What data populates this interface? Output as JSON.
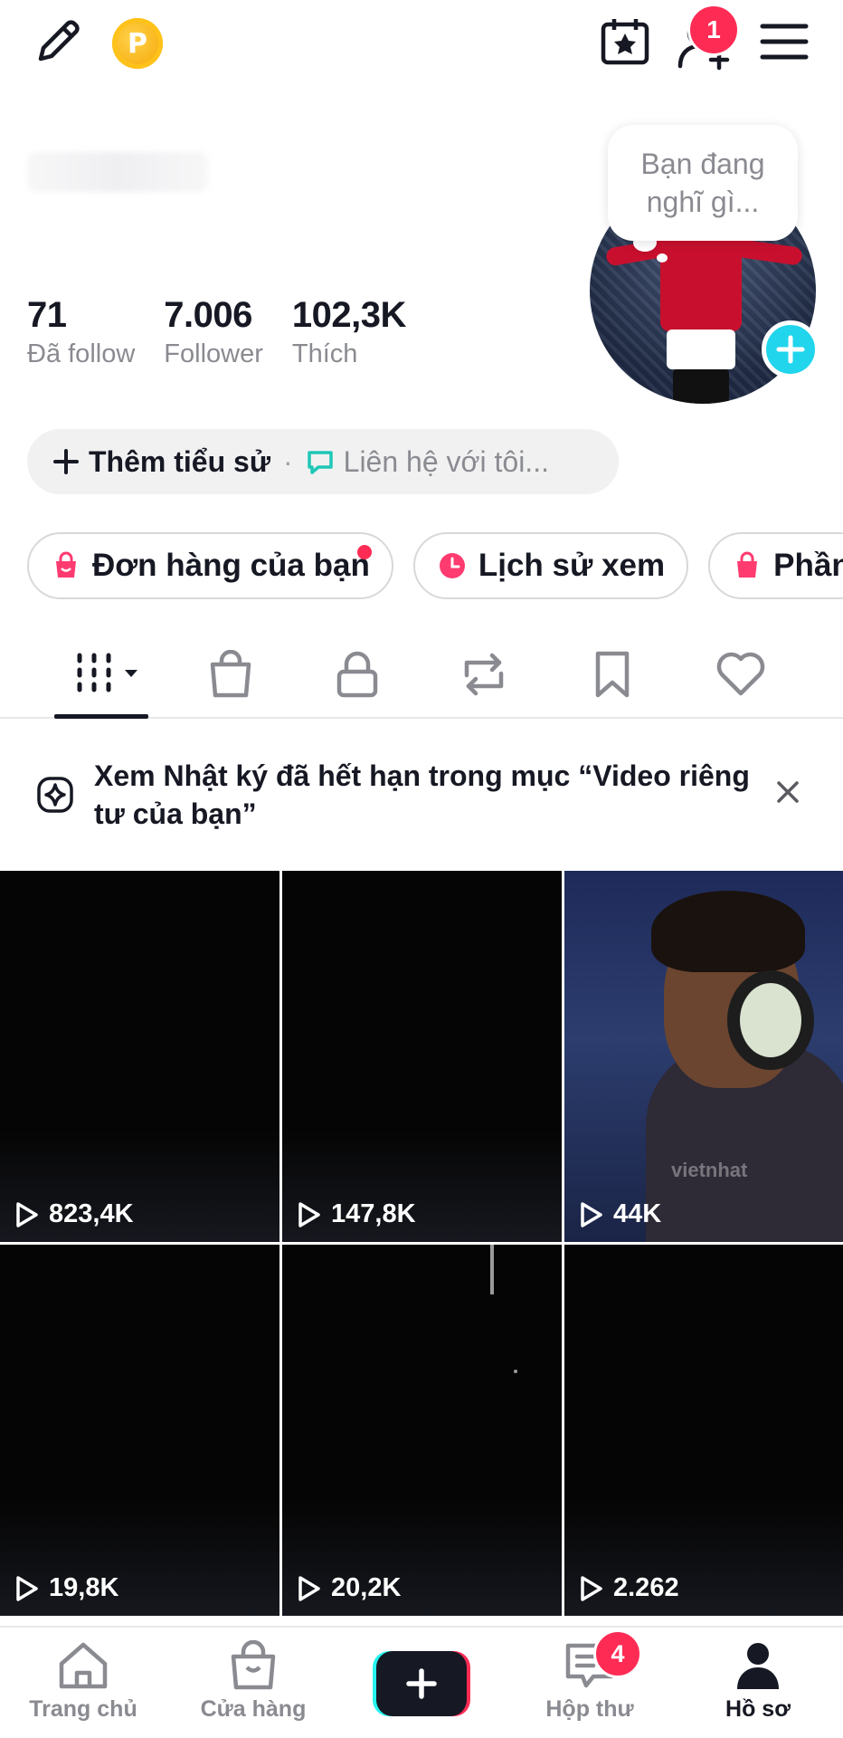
{
  "topbar": {
    "edit_icon": "pencil-icon",
    "points_badge": "P",
    "calendar_icon": "calendar-star-icon",
    "add_friend_badge": "1",
    "menu_icon": "hamburger-icon"
  },
  "profile": {
    "thought_bubble": "Bạn đang nghĩ gì...",
    "stats": [
      {
        "value": "71",
        "label": "Đã follow"
      },
      {
        "value": "7.006",
        "label": "Follower"
      },
      {
        "value": "102,3K",
        "label": "Thích"
      }
    ],
    "add_bio": "Thêm tiểu sử",
    "separator": "·",
    "contact": "Liên hệ với tôi..."
  },
  "chips": [
    {
      "label": "Đơn hàng của bạn",
      "icon": "shopping-bag-icon"
    },
    {
      "label": "Lịch sử xem",
      "icon": "clock-icon"
    },
    {
      "label": "Phần",
      "icon": "shopping-bag-icon"
    }
  ],
  "notice": {
    "text": "Xem Nhật ký đã hết hạn trong mục “Video riêng tư của bạn”"
  },
  "videos": [
    {
      "views": "823,4K"
    },
    {
      "views": "147,8K"
    },
    {
      "views": "44K",
      "watermark": "vietnhat"
    },
    {
      "views": "19,8K"
    },
    {
      "views": "20,2K"
    },
    {
      "views": "2.262"
    }
  ],
  "bottom_nav": {
    "home": "Trang chủ",
    "shop": "Cửa hàng",
    "inbox": "Hộp thư",
    "inbox_badge": "4",
    "profile": "Hồ sơ"
  },
  "colors": {
    "accent_red": "#fe2c55",
    "accent_cyan": "#25f4ee",
    "text_primary": "#161823",
    "text_secondary": "#8a8b91"
  }
}
